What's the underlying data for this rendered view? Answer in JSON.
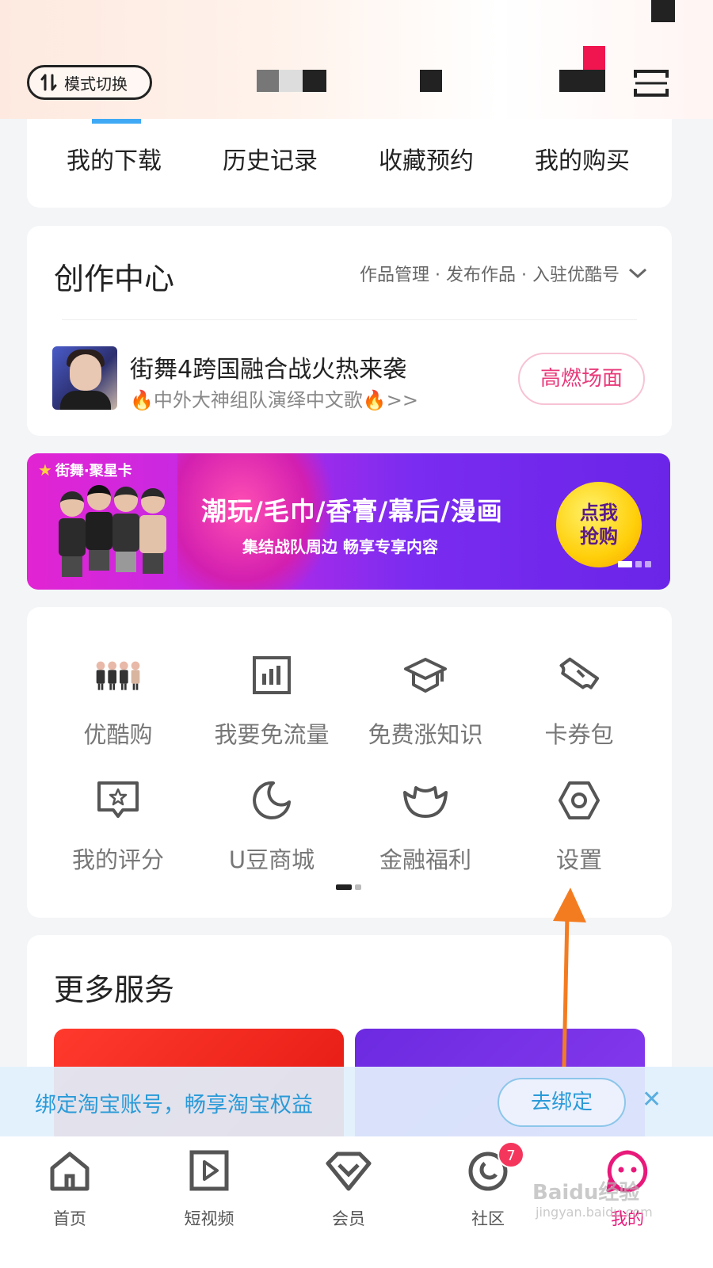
{
  "header": {
    "mode_switch_label": "模式切换"
  },
  "quick_row": {
    "items": [
      "我的下载",
      "历史记录",
      "收藏预约",
      "我的购买"
    ]
  },
  "creation_center": {
    "title": "创作中心",
    "links": "作品管理 · 发布作品 · 入驻优酷号",
    "promo_title": "街舞4跨国融合战火热来袭",
    "promo_sub_prefix": "🔥",
    "promo_sub": "中外大神组队演绎中文歌",
    "promo_sub_suffix": "🔥>>",
    "promo_button": "高燃场面"
  },
  "banner": {
    "tag": "街舞·聚星卡",
    "title": "潮玩/毛巾/香膏/幕后/漫画",
    "subtitle": "集结战队周边 畅享专享内容",
    "cta_line1": "点我",
    "cta_line2": "抢购"
  },
  "tools": {
    "items": [
      {
        "label": "优酷购",
        "icon": "figures-icon"
      },
      {
        "label": "我要免流量",
        "icon": "traffic-icon"
      },
      {
        "label": "免费涨知识",
        "icon": "graduation-cap-icon"
      },
      {
        "label": "卡券包",
        "icon": "ticket-icon"
      },
      {
        "label": "我的评分",
        "icon": "rating-icon"
      },
      {
        "label": "U豆商城",
        "icon": "moon-coin-icon"
      },
      {
        "label": "金融福利",
        "icon": "ingot-icon"
      },
      {
        "label": "设置",
        "icon": "gear-icon"
      }
    ]
  },
  "more_services": {
    "title": "更多服务"
  },
  "bind_bar": {
    "text": "绑定淘宝账号，畅享淘宝权益",
    "button": "去绑定",
    "close": "✕"
  },
  "tabbar": {
    "tabs": [
      {
        "label": "首页",
        "icon": "home-icon"
      },
      {
        "label": "短视频",
        "icon": "play-icon"
      },
      {
        "label": "会员",
        "icon": "diamond-icon"
      },
      {
        "label": "社区",
        "icon": "community-icon",
        "badge": "7"
      },
      {
        "label": "我的",
        "icon": "profile-icon",
        "active": true
      }
    ]
  },
  "watermark": {
    "line1": "Baidu经验",
    "line2": "jingyan.baidu.com"
  },
  "colors": {
    "accent": "#e8197a",
    "link_blue": "#2a9ad8",
    "arrow": "#f47c20"
  }
}
